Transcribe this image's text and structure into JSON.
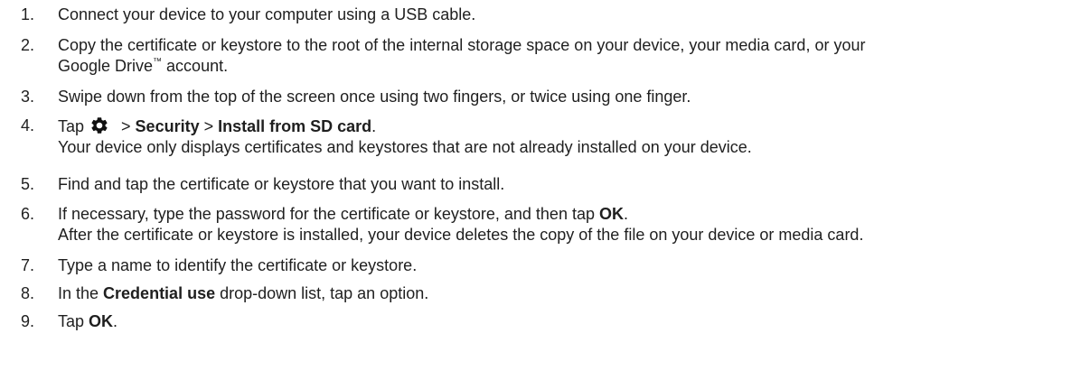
{
  "steps": [
    {
      "num": "1.",
      "text": "Connect your device to your computer using a USB cable."
    },
    {
      "num": "2.",
      "line1": "Copy the certificate or keystore to the root of the internal storage space on your device, your media card, or your",
      "line2_pre": "Google Drive",
      "tm": "™",
      "line2_post": " account."
    },
    {
      "num": "3.",
      "text": "Swipe down from the top of the screen once using two fingers, or twice using one finger."
    },
    {
      "num": "4.",
      "tap": "Tap",
      "sep1": " > ",
      "security": "Security",
      "sep2": " > ",
      "install": "Install from SD card",
      "end": ".",
      "note": "Your device only displays certificates and keystores that are not already installed on your device.",
      "icon": "gear-icon"
    },
    {
      "num": "5.",
      "text": "Find and tap the certificate or keystore that you want to install."
    },
    {
      "num": "6.",
      "line1_pre": "If necessary, type the password for the certificate or keystore, and then tap ",
      "ok": "OK",
      "line1_post": ".",
      "note": "After the certificate or keystore is installed, your device deletes the copy of the file on your device or media card."
    },
    {
      "num": "7.",
      "text": "Type a name to identify the certificate or keystore."
    },
    {
      "num": "8.",
      "pre": "In the ",
      "bold": "Credential use",
      "post": " drop-down list, tap an option."
    },
    {
      "num": "9.",
      "pre": "Tap ",
      "bold": "OK",
      "post": "."
    }
  ]
}
